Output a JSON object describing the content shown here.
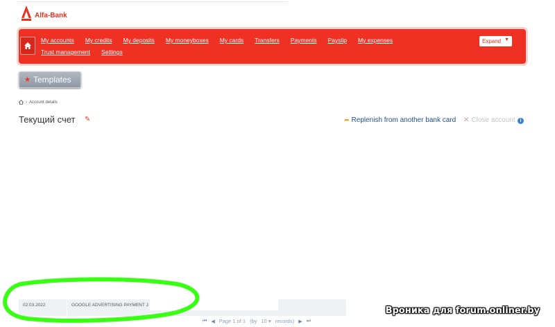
{
  "brand": {
    "name": "Alfa-Bank",
    "color": "#ef3124"
  },
  "menu": {
    "row1": [
      "My accounts",
      "My credits",
      "My deposits",
      "My moneyboxes",
      "My cards",
      "Transfers",
      "Payments",
      "Payslip",
      "My expenses"
    ],
    "row2": [
      "Trust management",
      "Settings"
    ],
    "expand_label": "Expand",
    "home_icon": "home-icon"
  },
  "templates": {
    "label": "Templates"
  },
  "breadcrumb": {
    "current": "Account details"
  },
  "page": {
    "title": "Текущий счет"
  },
  "actions": {
    "replenish_label": "Replenish from another bank card",
    "close_label": "Close account"
  },
  "transactions": [
    {
      "date": "02.03.2022",
      "description": "GOOGLE ADVERTISING PAYMENT J"
    }
  ],
  "pager": {
    "page_label": "Page 1 of 1",
    "by_label": "(by",
    "per_page": "10",
    "records_label": "records)"
  },
  "watermark": {
    "text": "Вроника для forum.onliner.by"
  },
  "colors": {
    "highlight_marker": "#39ff14",
    "link": "#1f4e8c"
  }
}
